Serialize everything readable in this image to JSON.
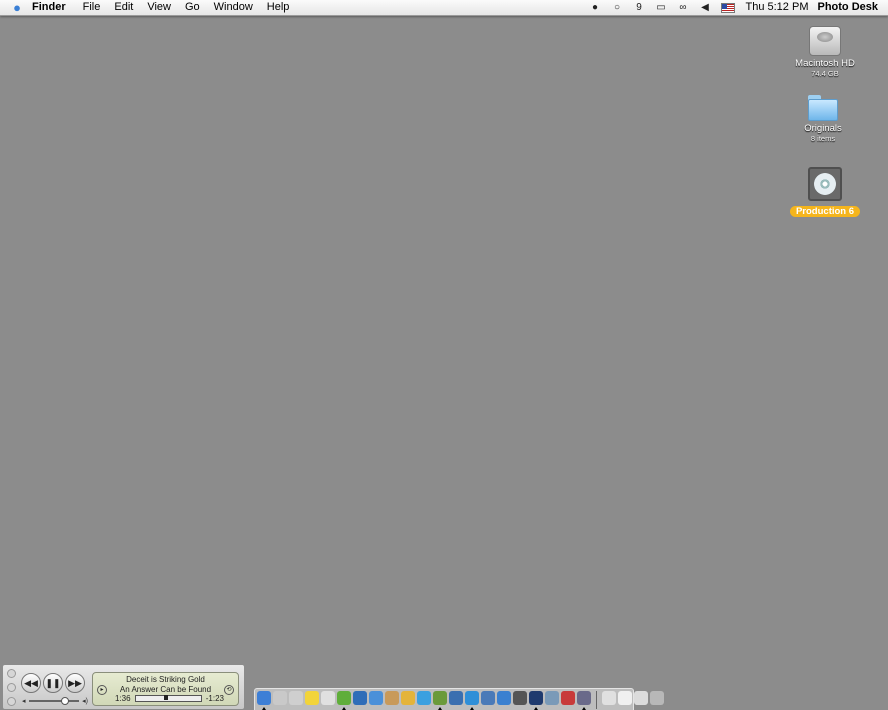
{
  "menubar": {
    "apple_icon": "apple-icon",
    "app_name": "Finder",
    "menus": [
      "File",
      "Edit",
      "View",
      "Go",
      "Window",
      "Help"
    ],
    "status_icons": [
      "spy-icon",
      "chat-bubble-icon",
      "nine-icon",
      "display-icon",
      "binoculars-icon",
      "speaker-icon",
      "us-flag-icon"
    ],
    "clock": "Thu 5:12 PM",
    "user": "Photo Desk"
  },
  "desktop": {
    "icons": [
      {
        "name": "Macintosh HD",
        "sub": "74.4 GB",
        "icon": "hard-drive-icon"
      },
      {
        "name": "Originals",
        "sub": "8 items",
        "icon": "folder-icon"
      },
      {
        "name": "Production 6",
        "sub": "",
        "icon": "disc-icon",
        "selected": true
      }
    ]
  },
  "itunes_mini": {
    "song": "Deceit is Striking Gold",
    "artist": "An Answer Can be Found",
    "elapsed": "1:36",
    "remaining": "-1:23",
    "buttons": [
      "rewind-icon",
      "pause-icon",
      "fast-forward-icon"
    ],
    "volume_level": 0.5
  },
  "dock": {
    "apps": [
      {
        "icon": "finder-icon",
        "color": "#3d7fd6",
        "running": true
      },
      {
        "icon": "mail-icon",
        "color": "#c9c9c9",
        "running": false
      },
      {
        "icon": "trash-icon",
        "color": "#cfcfcf",
        "running": false
      },
      {
        "icon": "stickies-icon",
        "color": "#f2d43a",
        "running": false
      },
      {
        "icon": "ical-icon",
        "color": "#e0e0e0",
        "running": false
      },
      {
        "icon": "itunes-icon",
        "color": "#5fae3a",
        "running": true
      },
      {
        "icon": "iphoto-icon",
        "color": "#2f6db8",
        "running": false
      },
      {
        "icon": "imovie-icon",
        "color": "#4a90d9",
        "running": false
      },
      {
        "icon": "address-book-icon",
        "color": "#c89a5a",
        "running": false
      },
      {
        "icon": "preview-icon",
        "color": "#e4b43a",
        "running": false
      },
      {
        "icon": "ichat-icon",
        "color": "#3aa0e0",
        "running": false
      },
      {
        "icon": "utilities-icon",
        "color": "#6a9a3a",
        "running": true
      },
      {
        "icon": "network-icon",
        "color": "#3a6fb0",
        "running": false
      },
      {
        "icon": "safari-icon",
        "color": "#2f8fd8",
        "running": true
      },
      {
        "icon": "sherlock-icon",
        "color": "#4a7ab8",
        "running": false
      },
      {
        "icon": "disk-icon",
        "color": "#3a80d0",
        "running": false
      },
      {
        "icon": "terminal-icon",
        "color": "#555555",
        "running": false
      },
      {
        "icon": "photoshop-icon",
        "color": "#1f3a6e",
        "running": true
      },
      {
        "icon": "pen-icon",
        "color": "#7a9ab8",
        "running": false
      },
      {
        "icon": "acrobat-icon",
        "color": "#c83a3a",
        "running": false
      },
      {
        "icon": "system-prefs-icon",
        "color": "#6a6a8a",
        "running": true
      }
    ],
    "docs": [
      {
        "icon": "document-icon",
        "color": "#e0e0e0"
      },
      {
        "icon": "printer-icon",
        "color": "#f0f0f0"
      },
      {
        "icon": "window-icon",
        "color": "#dcdcdc"
      },
      {
        "icon": "trash-can-icon",
        "color": "#b8b8b8"
      }
    ]
  }
}
